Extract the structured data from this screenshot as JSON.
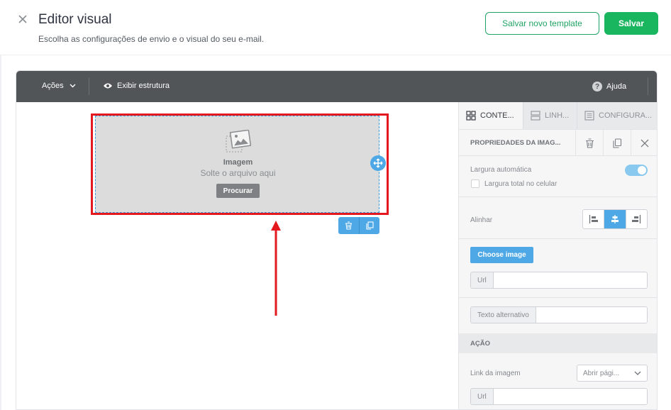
{
  "header": {
    "title": "Editor visual",
    "subtitle": "Escolha as configurações de envio e o visual do seu e-mail.",
    "save_template_label": "Salvar novo template",
    "save_label": "Salvar"
  },
  "toolbar": {
    "actions_label": "Ações",
    "structure_label": "Exibir estrutura",
    "help_label": "Ajuda"
  },
  "image_block": {
    "title": "Imagem",
    "subtitle": "Solte o arquivo aqui",
    "browse_label": "Procurar"
  },
  "panel": {
    "tabs": [
      {
        "label": "CONTE..."
      },
      {
        "label": "LINH..."
      },
      {
        "label": "CONFIGURA..."
      }
    ],
    "properties_title": "PROPRIEDADES DA IMAG...",
    "auto_width_label": "Largura automática",
    "full_width_mobile_label": "Largura total no celular",
    "align_label": "Alinhar",
    "choose_image_label": "Choose image",
    "url_prefix": "Url",
    "url_value": "",
    "alt_text_prefix": "Texto alternativo",
    "alt_text_value": "",
    "action_section": "AÇÃO",
    "image_link_label": "Link da imagem",
    "link_select_value": "Abrir pági...",
    "link_url_prefix": "Url",
    "link_url_value": ""
  },
  "colors": {
    "brand_green": "#19b55f",
    "accent_blue": "#4ea8e6",
    "highlight_red": "#e3191f",
    "toolbar_dark": "#515558"
  }
}
